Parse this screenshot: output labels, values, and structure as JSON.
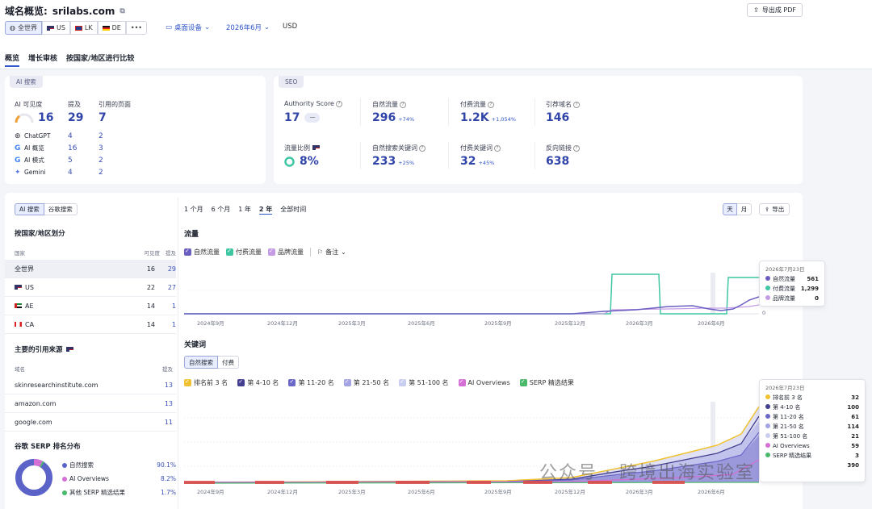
{
  "header": {
    "title": "域名概览:",
    "domain": "srilabs.com",
    "export_pdf": "导出成 PDF",
    "regions": [
      {
        "label": "全世界"
      },
      {
        "label": "US"
      },
      {
        "label": "LK"
      },
      {
        "label": "DE"
      },
      {
        "label": "•••"
      }
    ],
    "device": "桌面设备",
    "date": "2026年6月",
    "currency": "USD",
    "tabs": [
      "概览",
      "增长审核",
      "按国家/地区进行比较"
    ]
  },
  "ai_card": {
    "chip": "AI 搜索",
    "visibility_label": "AI 可见度",
    "visibility_value": "16",
    "mentions_label": "提及",
    "mentions_value": "29",
    "cited_label": "引用的页面",
    "cited_value": "7",
    "rows": [
      {
        "name": "ChatGPT",
        "mentions": "4",
        "cited": "2"
      },
      {
        "name": "AI 概览",
        "mentions": "16",
        "cited": "3"
      },
      {
        "name": "AI 模式",
        "mentions": "5",
        "cited": "2"
      },
      {
        "name": "Gemini",
        "mentions": "4",
        "cited": "2"
      }
    ]
  },
  "seo_card": {
    "chip": "SEO",
    "authority_label": "Authority Score",
    "authority_value": "17",
    "authority_trend": "一",
    "organic_label": "自然流量",
    "organic_value": "296",
    "organic_delta": "+74%",
    "paid_label": "付费流量",
    "paid_value": "1.2K",
    "paid_delta": "+1,054%",
    "refdomains_label": "引荐域名",
    "refdomains_value": "146",
    "share_label": "流量比例",
    "share_value": "8%",
    "org_kw_label": "自然搜索关键词",
    "org_kw_value": "233",
    "org_kw_delta": "+25%",
    "paid_kw_label": "付费关键词",
    "paid_kw_value": "32",
    "paid_kw_delta": "+45%",
    "backlinks_label": "反向链接",
    "backlinks_value": "638"
  },
  "left_panel": {
    "toggle_ai": "AI 搜索",
    "toggle_google": "谷歌搜索",
    "by_country_title": "按国家/地区划分",
    "col_country": "国家",
    "col_visibility": "可见度",
    "col_mentions": "提及",
    "countries": [
      {
        "name": "全世界",
        "visibility": "16",
        "mentions": "29"
      },
      {
        "name": "US",
        "visibility": "22",
        "mentions": "27"
      },
      {
        "name": "AE",
        "visibility": "14",
        "mentions": "1"
      },
      {
        "name": "CA",
        "visibility": "14",
        "mentions": "1"
      }
    ],
    "sources_title": "主要的引用来源",
    "col_domain": "域名",
    "col_src_mentions": "提及",
    "sources": [
      {
        "domain": "skinresearchinstitute.com",
        "count": "13"
      },
      {
        "domain": "amazon.com",
        "count": "13"
      },
      {
        "domain": "google.com",
        "count": "11"
      }
    ],
    "serp_title": "谷歌 SERP 排名分布",
    "serp": [
      {
        "label": "自然搜索",
        "value": "90.1%",
        "color": "#5b63c9"
      },
      {
        "label": "AI Overviews",
        "value": "8.2%",
        "color": "#d46fd6"
      },
      {
        "label": "其他 SERP 精选结果",
        "value": "1.7%",
        "color": "#49b96a"
      }
    ]
  },
  "traffic": {
    "ranges": [
      "1 个月",
      "6 个月",
      "1 年",
      "2 年",
      "全部时间"
    ],
    "active_range": "2 年",
    "day": "天",
    "month": "月",
    "export": "导出",
    "title": "流量",
    "legend": [
      {
        "label": "自然流量",
        "color": "#6a5fc1"
      },
      {
        "label": "付费流量",
        "color": "#3fc7a4"
      },
      {
        "label": "品牌流量",
        "color": "#c59be6"
      }
    ],
    "notes": "备注",
    "x_ticks": [
      "2024年9月",
      "2024年12月",
      "2025年3月",
      "2025年6月",
      "2025年9月",
      "2025年12月",
      "2026年3月",
      "2026年6月"
    ],
    "y_zero": "0",
    "tooltip": {
      "date": "2026年7月23日",
      "rows": [
        {
          "label": "自然流量",
          "value": "561",
          "color": "#6a5fc1"
        },
        {
          "label": "付费流量",
          "value": "1,299",
          "color": "#3fc7a4"
        },
        {
          "label": "品牌流量",
          "value": "0",
          "color": "#c59be6"
        }
      ]
    }
  },
  "keywords": {
    "title": "关键词",
    "tab_organic": "自然搜索",
    "tab_paid": "付费",
    "legend": [
      {
        "label": "排名前 3 名",
        "color": "#f0c232"
      },
      {
        "label": "第 4-10 名",
        "color": "#433e8f"
      },
      {
        "label": "第 11-20 名",
        "color": "#6c68c7"
      },
      {
        "label": "第 21-50 名",
        "color": "#a4a3e3"
      },
      {
        "label": "第 51-100 名",
        "color": "#c9cdef"
      },
      {
        "label": "AI Overviews",
        "color": "#d46fd6"
      },
      {
        "label": "SERP 精选结果",
        "color": "#49b96a"
      }
    ],
    "x_ticks": [
      "2024年9月",
      "2024年12月",
      "2025年3月",
      "2025年6月",
      "2025年9月",
      "2025年12月",
      "2026年3月",
      "2026年6月"
    ],
    "tooltip": {
      "date": "2026年7月23日",
      "rows": [
        {
          "label": "排名前 3 名",
          "value": "32",
          "color": "#f0c232"
        },
        {
          "label": "第 4-10 名",
          "value": "100",
          "color": "#433e8f"
        },
        {
          "label": "第 11-20 名",
          "value": "61",
          "color": "#6c68c7"
        },
        {
          "label": "第 21-50 名",
          "value": "114",
          "color": "#a4a3e3"
        },
        {
          "label": "第 51-100 名",
          "value": "21",
          "color": "#c9cdef"
        },
        {
          "label": "AI Overviews",
          "value": "59",
          "color": "#d46fd6"
        },
        {
          "label": "SERP 精选结果",
          "value": "3",
          "color": "#49b96a"
        }
      ],
      "total": "390"
    }
  },
  "watermark": "公众号 · 跨境出海实验室"
}
